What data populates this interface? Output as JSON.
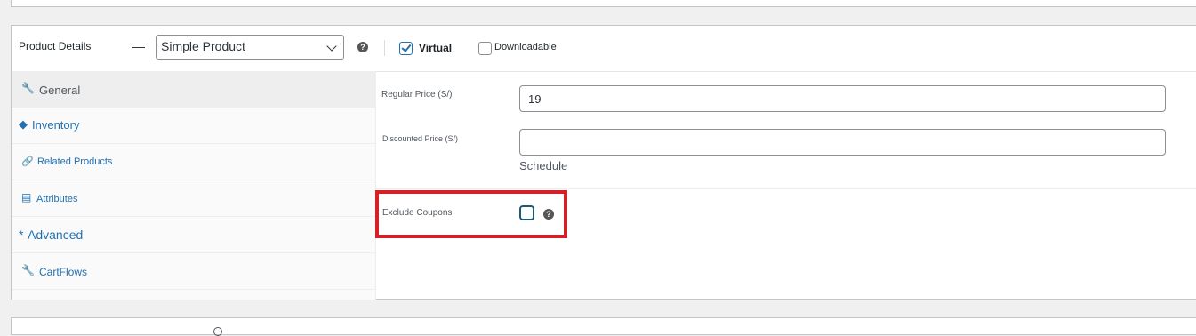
{
  "product_details": {
    "title": "Product Details",
    "dash": "—",
    "product_type": {
      "selected": "Simple Product",
      "icon": "chevron-down-icon"
    },
    "help_icon": "?",
    "virtual": {
      "label": "Virtual",
      "checked": true
    },
    "downloadable": {
      "label": "Downloadable",
      "checked": false
    }
  },
  "tabs": [
    {
      "label": "General",
      "icon": "wrench-icon",
      "glyph": "🔧",
      "active": true
    },
    {
      "label": "Inventory",
      "icon": "diamond-icon",
      "glyph": "◆",
      "active": false
    },
    {
      "label": "Related Products",
      "icon": "link-icon",
      "glyph": "🔗",
      "active": false
    },
    {
      "label": "Attributes",
      "icon": "attributes-icon",
      "glyph": "▤",
      "active": false
    },
    {
      "label": "Advanced",
      "icon": "asterisk-icon",
      "glyph": "*",
      "active": false
    },
    {
      "label": "CartFlows",
      "icon": "wrench-icon",
      "glyph": "🔧",
      "active": false
    }
  ],
  "general": {
    "regular_price": {
      "label": "Regular Price (S/)",
      "value": "19"
    },
    "discounted_price": {
      "label": "Discounted Price (S/)",
      "value": ""
    },
    "schedule_link": "Schedule",
    "exclude_coupons": {
      "label": "Exclude Coupons",
      "checked": false,
      "help": "?"
    }
  },
  "colors": {
    "accent": "#2271b1",
    "highlight": "#d42026",
    "page_bg": "#f0f0f1"
  }
}
